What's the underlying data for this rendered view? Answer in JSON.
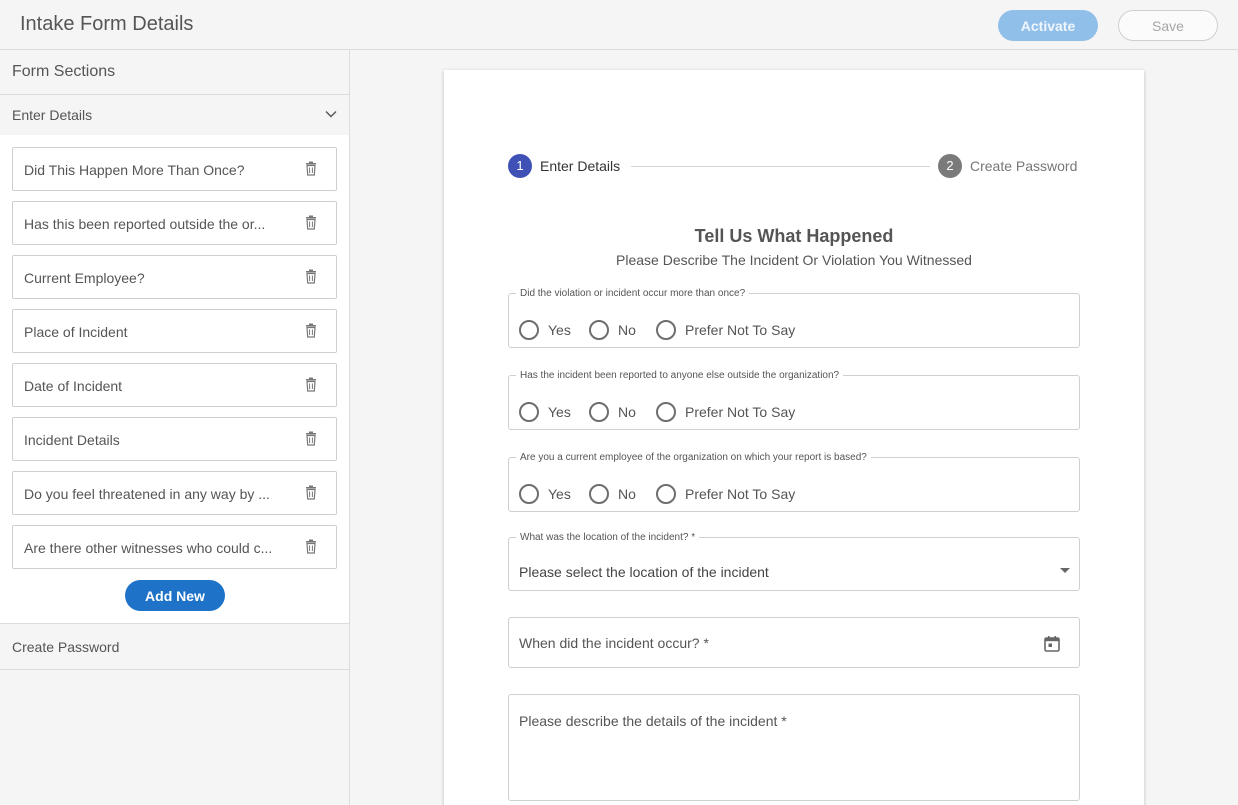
{
  "header": {
    "title": "Intake Form Details",
    "activate_label": "Activate",
    "save_label": "Save"
  },
  "sidebar": {
    "title": "Form Sections",
    "section_enter": "Enter Details",
    "items": [
      {
        "label": "Did This Happen More Than Once?"
      },
      {
        "label": "Has this been reported outside the or..."
      },
      {
        "label": "Current Employee?"
      },
      {
        "label": "Place of Incident"
      },
      {
        "label": "Date of Incident"
      },
      {
        "label": "Incident Details"
      },
      {
        "label": "Do you feel threatened in any way by ..."
      },
      {
        "label": "Are there other witnesses who could c..."
      }
    ],
    "add_label": "Add New",
    "section_password": "Create Password"
  },
  "stepper": {
    "step1": {
      "num": "1",
      "label": "Enter Details"
    },
    "step2": {
      "num": "2",
      "label": "Create Password"
    }
  },
  "form": {
    "title": "Tell Us What Happened",
    "subtitle": "Please Describe The Incident Or Violation You Witnessed",
    "questions": [
      {
        "legend": "Did the violation or incident occur more than once?",
        "options": [
          "Yes",
          "No",
          "Prefer Not To Say"
        ]
      },
      {
        "legend": "Has the incident been reported to anyone else outside the organization?",
        "options": [
          "Yes",
          "No",
          "Prefer Not To Say"
        ]
      },
      {
        "legend": "Are you a current employee of the organization on which your report is based?",
        "options": [
          "Yes",
          "No",
          "Prefer Not To Say"
        ]
      }
    ],
    "location": {
      "legend": "What was the location of the incident? *",
      "value": "Please select the location of the incident"
    },
    "date_placeholder": "When did the incident occur? *",
    "details_placeholder": "Please describe the details of the incident *"
  },
  "colors": {
    "accent": "#1e73c8",
    "accent_disabled": "#90bfe9",
    "step_active": "#3f51b5",
    "step_inactive": "#7a7a7a"
  },
  "icons": [
    "chevron-down-icon",
    "trash-icon",
    "caret-down-icon",
    "calendar-icon"
  ]
}
